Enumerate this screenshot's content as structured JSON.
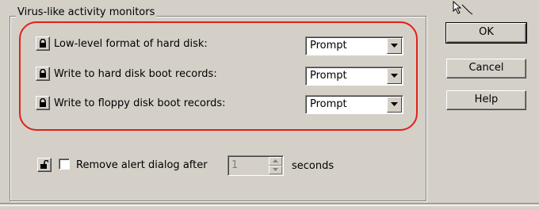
{
  "group": {
    "title": "Virus-like activity monitors"
  },
  "settings": [
    {
      "label": "Low-level format of hard disk:",
      "value": "Prompt",
      "lock": "lock-closed-icon"
    },
    {
      "label": "Write to hard disk boot records:",
      "value": "Prompt",
      "lock": "lock-closed-icon"
    },
    {
      "label": "Write to floppy disk boot records:",
      "value": "Prompt",
      "lock": "lock-closed-icon"
    }
  ],
  "buttons": {
    "ok": "OK",
    "cancel": "Cancel",
    "help": "Help"
  },
  "alert": {
    "label": "Remove alert dialog after",
    "checked": false,
    "seconds_value": "1",
    "suffix": "seconds",
    "lock": "lock-open-icon"
  },
  "colors": {
    "highlight_oval": "#e0211a",
    "dialog_bg": "#d4d0c8"
  }
}
